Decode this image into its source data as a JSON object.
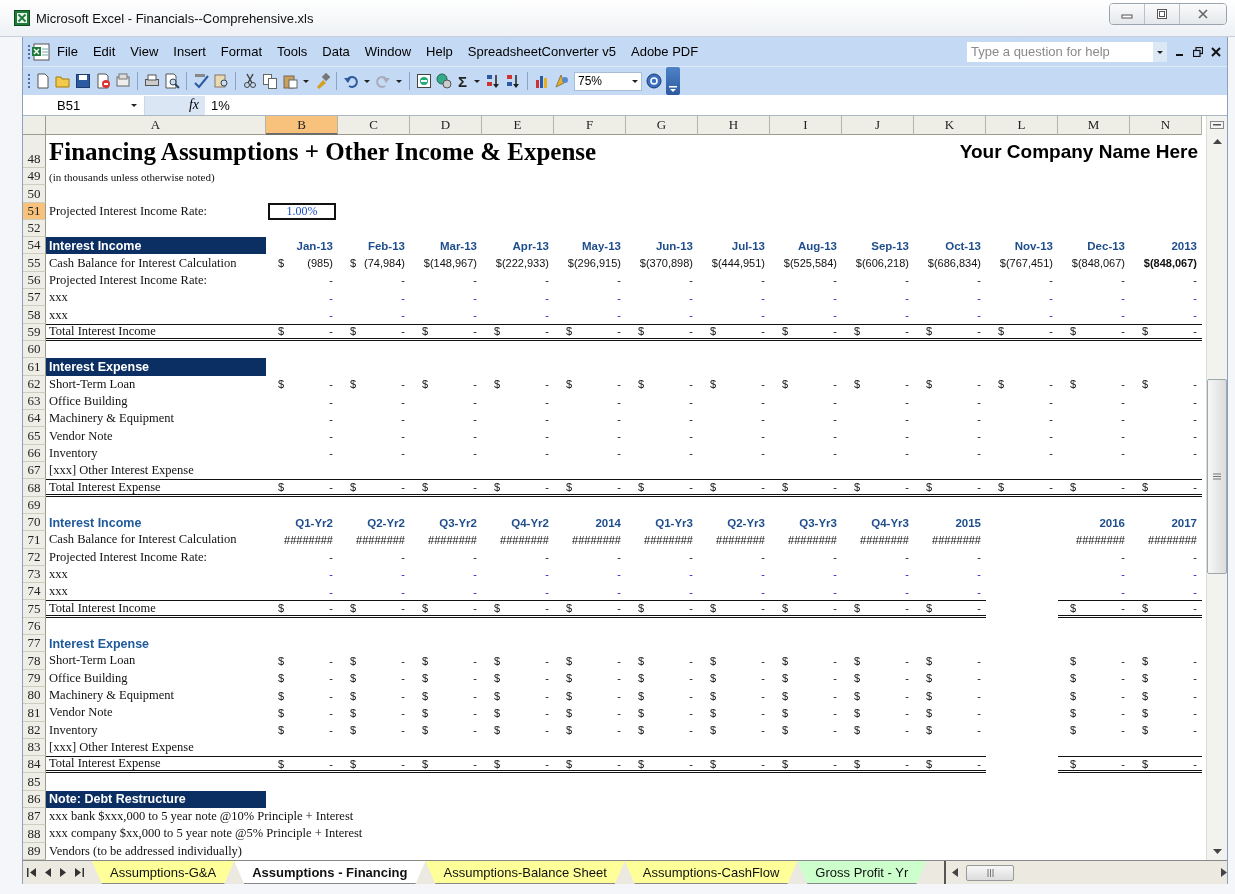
{
  "window": {
    "title": "Microsoft Excel - Financials--Comprehensive.xls"
  },
  "menu": [
    "File",
    "Edit",
    "View",
    "Insert",
    "Format",
    "Tools",
    "Data",
    "Window",
    "Help",
    "SpreadsheetConverter v5",
    "Adobe PDF"
  ],
  "help_box": {
    "placeholder": "Type a question for help"
  },
  "toolbar": {
    "sum_symbol": "Σ",
    "zoom": "75%"
  },
  "formula_bar": {
    "name_box": "B51",
    "function_label": "fx",
    "value": "1%"
  },
  "columns": [
    {
      "label": "A",
      "selected": false
    },
    {
      "label": "B",
      "selected": true
    },
    {
      "label": "C",
      "selected": false
    },
    {
      "label": "D",
      "selected": false
    },
    {
      "label": "E",
      "selected": false
    },
    {
      "label": "F",
      "selected": false
    },
    {
      "label": "G",
      "selected": false
    },
    {
      "label": "H",
      "selected": false
    },
    {
      "label": "I",
      "selected": false
    },
    {
      "label": "J",
      "selected": false
    },
    {
      "label": "K",
      "selected": false
    },
    {
      "label": "L",
      "selected": false
    },
    {
      "label": "M",
      "selected": false
    },
    {
      "label": "N",
      "selected": false
    }
  ],
  "rows": [
    {
      "num": "48",
      "selected": false,
      "kind": "title",
      "label": "Financing Assumptions + Other Income & Expense",
      "right": "Your Company Name Here"
    },
    {
      "num": "49",
      "selected": false,
      "kind": "note",
      "label": "(in thousands unless otherwise noted)"
    },
    {
      "num": "50",
      "selected": false,
      "kind": "blank"
    },
    {
      "num": "51",
      "selected": true,
      "kind": "rate",
      "label": "Projected Interest Income Rate:",
      "value": "1.00%"
    },
    {
      "num": "52",
      "selected": false,
      "kind": "blank"
    },
    {
      "num": "54",
      "selected": false,
      "kind": "band",
      "label": "Interest Income",
      "cells": [
        {
          "v": "Jan-13"
        },
        {
          "v": "Feb-13"
        },
        {
          "v": "Mar-13"
        },
        {
          "v": "Apr-13"
        },
        {
          "v": "May-13"
        },
        {
          "v": "Jun-13"
        },
        {
          "v": "Jul-13"
        },
        {
          "v": "Aug-13"
        },
        {
          "v": "Sep-13"
        },
        {
          "v": "Oct-13"
        },
        {
          "v": "Nov-13"
        },
        {
          "v": "Dec-13"
        },
        {
          "v": "2013"
        }
      ]
    },
    {
      "num": "55",
      "selected": false,
      "kind": "data",
      "label": "Cash Balance for Interest Calculation",
      "cells": [
        {
          "s": "$",
          "v": "(985)"
        },
        {
          "s": "$",
          "v": "(74,984)"
        },
        {
          "v": "$(148,967)"
        },
        {
          "v": "$(222,933)"
        },
        {
          "v": "$(296,915)"
        },
        {
          "v": "$(370,898)"
        },
        {
          "v": "$(444,951)"
        },
        {
          "v": "$(525,584)"
        },
        {
          "v": "$(606,218)"
        },
        {
          "v": "$(686,834)"
        },
        {
          "v": "$(767,451)"
        },
        {
          "v": "$(848,067)"
        },
        {
          "v": "$(848,067)",
          "bold": true
        }
      ]
    },
    {
      "num": "56",
      "selected": false,
      "kind": "data",
      "label": "Projected Interest Income Rate:",
      "cells": [
        {
          "v": "-"
        },
        {
          "v": "-"
        },
        {
          "v": "-"
        },
        {
          "v": "-"
        },
        {
          "v": "-"
        },
        {
          "v": "-"
        },
        {
          "v": "-"
        },
        {
          "v": "-"
        },
        {
          "v": "-"
        },
        {
          "v": "-"
        },
        {
          "v": "-"
        },
        {
          "v": "-"
        },
        {
          "v": "-"
        }
      ]
    },
    {
      "num": "57",
      "selected": false,
      "kind": "input",
      "label": "xxx",
      "cells": [
        {
          "v": "-"
        },
        {
          "v": "-"
        },
        {
          "v": "-"
        },
        {
          "v": "-"
        },
        {
          "v": "-"
        },
        {
          "v": "-"
        },
        {
          "v": "-"
        },
        {
          "v": "-"
        },
        {
          "v": "-"
        },
        {
          "v": "-"
        },
        {
          "v": "-"
        },
        {
          "v": "-"
        },
        {
          "v": "-"
        }
      ]
    },
    {
      "num": "58",
      "selected": false,
      "kind": "input",
      "label": "xxx",
      "cells": [
        {
          "v": "-"
        },
        {
          "v": "-"
        },
        {
          "v": "-"
        },
        {
          "v": "-"
        },
        {
          "v": "-"
        },
        {
          "v": "-"
        },
        {
          "v": "-"
        },
        {
          "v": "-"
        },
        {
          "v": "-"
        },
        {
          "v": "-"
        },
        {
          "v": "-"
        },
        {
          "v": "-"
        },
        {
          "v": "-"
        }
      ]
    },
    {
      "num": "59",
      "selected": false,
      "kind": "total",
      "label": "Total Interest Income",
      "cells": [
        {
          "s": "$",
          "v": "-"
        },
        {
          "s": "$",
          "v": "-"
        },
        {
          "s": "$",
          "v": "-"
        },
        {
          "s": "$",
          "v": "-"
        },
        {
          "s": "$",
          "v": "-"
        },
        {
          "s": "$",
          "v": "-"
        },
        {
          "s": "$",
          "v": "-"
        },
        {
          "s": "$",
          "v": "-"
        },
        {
          "s": "$",
          "v": "-"
        },
        {
          "s": "$",
          "v": "-"
        },
        {
          "s": "$",
          "v": "-"
        },
        {
          "s": "$",
          "v": "-"
        },
        {
          "s": "$",
          "v": "-"
        }
      ]
    },
    {
      "num": "60",
      "selected": false,
      "kind": "blank"
    },
    {
      "num": "61",
      "selected": false,
      "kind": "band",
      "label": "Interest Expense"
    },
    {
      "num": "62",
      "selected": false,
      "kind": "data",
      "label": "Short-Term Loan",
      "cells": [
        {
          "s": "$",
          "v": "-"
        },
        {
          "s": "$",
          "v": "-"
        },
        {
          "s": "$",
          "v": "-"
        },
        {
          "s": "$",
          "v": "-"
        },
        {
          "s": "$",
          "v": "-"
        },
        {
          "s": "$",
          "v": "-"
        },
        {
          "s": "$",
          "v": "-"
        },
        {
          "s": "$",
          "v": "-"
        },
        {
          "s": "$",
          "v": "-"
        },
        {
          "s": "$",
          "v": "-"
        },
        {
          "s": "$",
          "v": "-"
        },
        {
          "s": "$",
          "v": "-"
        },
        {
          "s": "$",
          "v": "-"
        }
      ]
    },
    {
      "num": "63",
      "selected": false,
      "kind": "data",
      "label": "Office Building",
      "cells": [
        {
          "v": "-"
        },
        {
          "v": "-"
        },
        {
          "v": "-"
        },
        {
          "v": "-"
        },
        {
          "v": "-"
        },
        {
          "v": "-"
        },
        {
          "v": "-"
        },
        {
          "v": "-"
        },
        {
          "v": "-"
        },
        {
          "v": "-"
        },
        {
          "v": "-"
        },
        {
          "v": "-"
        },
        {
          "v": "-"
        }
      ]
    },
    {
      "num": "64",
      "selected": false,
      "kind": "data",
      "label": "Machinery & Equipment",
      "cells": [
        {
          "v": "-"
        },
        {
          "v": "-"
        },
        {
          "v": "-"
        },
        {
          "v": "-"
        },
        {
          "v": "-"
        },
        {
          "v": "-"
        },
        {
          "v": "-"
        },
        {
          "v": "-"
        },
        {
          "v": "-"
        },
        {
          "v": "-"
        },
        {
          "v": "-"
        },
        {
          "v": "-"
        },
        {
          "v": "-"
        }
      ]
    },
    {
      "num": "65",
      "selected": false,
      "kind": "data",
      "label": "Vendor Note",
      "cells": [
        {
          "v": "-"
        },
        {
          "v": "-"
        },
        {
          "v": "-"
        },
        {
          "v": "-"
        },
        {
          "v": "-"
        },
        {
          "v": "-"
        },
        {
          "v": "-"
        },
        {
          "v": "-"
        },
        {
          "v": "-"
        },
        {
          "v": "-"
        },
        {
          "v": "-"
        },
        {
          "v": "-"
        },
        {
          "v": "-"
        }
      ]
    },
    {
      "num": "66",
      "selected": false,
      "kind": "data",
      "label": "Inventory",
      "cells": [
        {
          "v": "-"
        },
        {
          "v": "-"
        },
        {
          "v": "-"
        },
        {
          "v": "-"
        },
        {
          "v": "-"
        },
        {
          "v": "-"
        },
        {
          "v": "-"
        },
        {
          "v": "-"
        },
        {
          "v": "-"
        },
        {
          "v": "-"
        },
        {
          "v": "-"
        },
        {
          "v": "-"
        },
        {
          "v": "-"
        }
      ]
    },
    {
      "num": "67",
      "selected": false,
      "kind": "input",
      "label": "[xxx] Other Interest Expense"
    },
    {
      "num": "68",
      "selected": false,
      "kind": "total",
      "label": "Total Interest Expense",
      "cells": [
        {
          "s": "$",
          "v": "-"
        },
        {
          "s": "$",
          "v": "-"
        },
        {
          "s": "$",
          "v": "-"
        },
        {
          "s": "$",
          "v": "-"
        },
        {
          "s": "$",
          "v": "-"
        },
        {
          "s": "$",
          "v": "-"
        },
        {
          "s": "$",
          "v": "-"
        },
        {
          "s": "$",
          "v": "-"
        },
        {
          "s": "$",
          "v": "-"
        },
        {
          "s": "$",
          "v": "-"
        },
        {
          "s": "$",
          "v": "-"
        },
        {
          "s": "$",
          "v": "-"
        },
        {
          "s": "$",
          "v": "-"
        }
      ]
    },
    {
      "num": "69",
      "selected": false,
      "kind": "blank"
    },
    {
      "num": "70",
      "selected": false,
      "kind": "subhead",
      "label": "Interest Income",
      "cells": [
        {
          "v": "Q1-Yr2"
        },
        {
          "v": "Q2-Yr2"
        },
        {
          "v": "Q3-Yr2"
        },
        {
          "v": "Q4-Yr2"
        },
        {
          "v": "2014"
        },
        {
          "v": "Q1-Yr3"
        },
        {
          "v": "Q2-Yr3"
        },
        {
          "v": "Q3-Yr3"
        },
        {
          "v": "Q4-Yr3"
        },
        {
          "v": "2015"
        },
        null,
        {
          "v": "2016"
        },
        {
          "v": "2017"
        }
      ]
    },
    {
      "num": "71",
      "selected": false,
      "kind": "data",
      "label": "Cash Balance for Interest Calculation",
      "cells": [
        {
          "v": "########"
        },
        {
          "v": "########"
        },
        {
          "v": "########"
        },
        {
          "v": "########"
        },
        {
          "v": "########"
        },
        {
          "v": "########"
        },
        {
          "v": "########"
        },
        {
          "v": "########"
        },
        {
          "v": "########"
        },
        {
          "v": "########"
        },
        null,
        {
          "v": "########"
        },
        {
          "v": "########"
        }
      ]
    },
    {
      "num": "72",
      "selected": false,
      "kind": "data",
      "label": "Projected Interest Income Rate:",
      "cells": [
        {
          "v": "-"
        },
        {
          "v": "-"
        },
        {
          "v": "-"
        },
        {
          "v": "-"
        },
        {
          "v": "-"
        },
        {
          "v": "-"
        },
        {
          "v": "-"
        },
        {
          "v": "-"
        },
        {
          "v": "-"
        },
        {
          "v": "-"
        },
        null,
        {
          "v": "-"
        },
        {
          "v": "-"
        }
      ]
    },
    {
      "num": "73",
      "selected": false,
      "kind": "input",
      "label": "xxx",
      "cells": [
        {
          "v": "-"
        },
        {
          "v": "-"
        },
        {
          "v": "-"
        },
        {
          "v": "-"
        },
        {
          "v": "-"
        },
        {
          "v": "-"
        },
        {
          "v": "-"
        },
        {
          "v": "-"
        },
        {
          "v": "-"
        },
        {
          "v": "-"
        },
        null,
        {
          "v": "-"
        },
        {
          "v": "-"
        }
      ]
    },
    {
      "num": "74",
      "selected": false,
      "kind": "input",
      "label": "xxx",
      "cells": [
        {
          "v": "-"
        },
        {
          "v": "-"
        },
        {
          "v": "-"
        },
        {
          "v": "-"
        },
        {
          "v": "-"
        },
        {
          "v": "-"
        },
        {
          "v": "-"
        },
        {
          "v": "-"
        },
        {
          "v": "-"
        },
        {
          "v": "-"
        },
        null,
        {
          "v": "-"
        },
        {
          "v": "-"
        }
      ]
    },
    {
      "num": "75",
      "selected": false,
      "kind": "total",
      "label": "Total Interest Income",
      "cells": [
        {
          "s": "$",
          "v": "-"
        },
        {
          "s": "$",
          "v": "-"
        },
        {
          "s": "$",
          "v": "-"
        },
        {
          "s": "$",
          "v": "-"
        },
        {
          "s": "$",
          "v": "-"
        },
        {
          "s": "$",
          "v": "-"
        },
        {
          "s": "$",
          "v": "-"
        },
        {
          "s": "$",
          "v": "-"
        },
        {
          "s": "$",
          "v": "-"
        },
        {
          "s": "$",
          "v": "-"
        },
        null,
        {
          "s": "$",
          "v": "-"
        },
        {
          "s": "$",
          "v": "-"
        }
      ]
    },
    {
      "num": "76",
      "selected": false,
      "kind": "blank"
    },
    {
      "num": "77",
      "selected": false,
      "kind": "subhead",
      "label": "Interest Expense"
    },
    {
      "num": "78",
      "selected": false,
      "kind": "data",
      "label": "Short-Term Loan",
      "cells": [
        {
          "s": "$",
          "v": "-"
        },
        {
          "s": "$",
          "v": "-"
        },
        {
          "s": "$",
          "v": "-"
        },
        {
          "s": "$",
          "v": "-"
        },
        {
          "s": "$",
          "v": "-"
        },
        {
          "s": "$",
          "v": "-"
        },
        {
          "s": "$",
          "v": "-"
        },
        {
          "s": "$",
          "v": "-"
        },
        {
          "s": "$",
          "v": "-"
        },
        {
          "s": "$",
          "v": "-"
        },
        null,
        {
          "s": "$",
          "v": "-"
        },
        {
          "s": "$",
          "v": "-"
        }
      ]
    },
    {
      "num": "79",
      "selected": false,
      "kind": "data",
      "label": "Office Building",
      "cells": [
        {
          "s": "$",
          "v": "-"
        },
        {
          "s": "$",
          "v": "-"
        },
        {
          "s": "$",
          "v": "-"
        },
        {
          "s": "$",
          "v": "-"
        },
        {
          "s": "$",
          "v": "-"
        },
        {
          "s": "$",
          "v": "-"
        },
        {
          "s": "$",
          "v": "-"
        },
        {
          "s": "$",
          "v": "-"
        },
        {
          "s": "$",
          "v": "-"
        },
        {
          "s": "$",
          "v": "-"
        },
        null,
        {
          "s": "$",
          "v": "-"
        },
        {
          "s": "$",
          "v": "-"
        }
      ]
    },
    {
      "num": "80",
      "selected": false,
      "kind": "data",
      "label": "Machinery & Equipment",
      "cells": [
        {
          "s": "$",
          "v": "-"
        },
        {
          "s": "$",
          "v": "-"
        },
        {
          "s": "$",
          "v": "-"
        },
        {
          "s": "$",
          "v": "-"
        },
        {
          "s": "$",
          "v": "-"
        },
        {
          "s": "$",
          "v": "-"
        },
        {
          "s": "$",
          "v": "-"
        },
        {
          "s": "$",
          "v": "-"
        },
        {
          "s": "$",
          "v": "-"
        },
        {
          "s": "$",
          "v": "-"
        },
        null,
        {
          "s": "$",
          "v": "-"
        },
        {
          "s": "$",
          "v": "-"
        }
      ]
    },
    {
      "num": "81",
      "selected": false,
      "kind": "data",
      "label": "Vendor Note",
      "cells": [
        {
          "s": "$",
          "v": "-"
        },
        {
          "s": "$",
          "v": "-"
        },
        {
          "s": "$",
          "v": "-"
        },
        {
          "s": "$",
          "v": "-"
        },
        {
          "s": "$",
          "v": "-"
        },
        {
          "s": "$",
          "v": "-"
        },
        {
          "s": "$",
          "v": "-"
        },
        {
          "s": "$",
          "v": "-"
        },
        {
          "s": "$",
          "v": "-"
        },
        {
          "s": "$",
          "v": "-"
        },
        null,
        {
          "s": "$",
          "v": "-"
        },
        {
          "s": "$",
          "v": "-"
        }
      ]
    },
    {
      "num": "82",
      "selected": false,
      "kind": "data",
      "label": "Inventory",
      "cells": [
        {
          "s": "$",
          "v": "-"
        },
        {
          "s": "$",
          "v": "-"
        },
        {
          "s": "$",
          "v": "-"
        },
        {
          "s": "$",
          "v": "-"
        },
        {
          "s": "$",
          "v": "-"
        },
        {
          "s": "$",
          "v": "-"
        },
        {
          "s": "$",
          "v": "-"
        },
        {
          "s": "$",
          "v": "-"
        },
        {
          "s": "$",
          "v": "-"
        },
        {
          "s": "$",
          "v": "-"
        },
        null,
        {
          "s": "$",
          "v": "-"
        },
        {
          "s": "$",
          "v": "-"
        }
      ]
    },
    {
      "num": "83",
      "selected": false,
      "kind": "data",
      "label": "[xxx] Other Interest Expense"
    },
    {
      "num": "84",
      "selected": false,
      "kind": "total",
      "label": "Total Interest Expense",
      "cells": [
        {
          "s": "$",
          "v": "-"
        },
        {
          "s": "$",
          "v": "-"
        },
        {
          "s": "$",
          "v": "-"
        },
        {
          "s": "$",
          "v": "-"
        },
        {
          "s": "$",
          "v": "-"
        },
        {
          "s": "$",
          "v": "-"
        },
        {
          "s": "$",
          "v": "-"
        },
        {
          "s": "$",
          "v": "-"
        },
        {
          "s": "$",
          "v": "-"
        },
        {
          "s": "$",
          "v": "-"
        },
        null,
        {
          "s": "$",
          "v": "-"
        },
        {
          "s": "$",
          "v": "-"
        }
      ]
    },
    {
      "num": "85",
      "selected": false,
      "kind": "blank"
    },
    {
      "num": "86",
      "selected": false,
      "kind": "band",
      "label": "Note: Debt Restructure"
    },
    {
      "num": "87",
      "selected": false,
      "kind": "input",
      "label": "xxx bank $xxx,000 to 5 year note @10% Principle + Interest"
    },
    {
      "num": "88",
      "selected": false,
      "kind": "input",
      "label": "xxx company $xx,000 to 5 year note @5% Principle + Interest"
    },
    {
      "num": "89",
      "selected": false,
      "kind": "input",
      "label": "Vendors (to be addressed individually)"
    }
  ],
  "sheet_tabs": [
    {
      "label": "Assumptions-G&A",
      "selected": false,
      "color": "#ffff99"
    },
    {
      "label": "Assumptions - Financing",
      "selected": true,
      "color": "#ffffff"
    },
    {
      "label": "Assumptions-Balance Sheet",
      "selected": false,
      "color": "#ffff99"
    },
    {
      "label": "Assumptions-CashFlow",
      "selected": false,
      "color": "#ffff99"
    },
    {
      "label": "Gross Profit - Yr",
      "selected": false,
      "color": "#ccffcc"
    }
  ]
}
